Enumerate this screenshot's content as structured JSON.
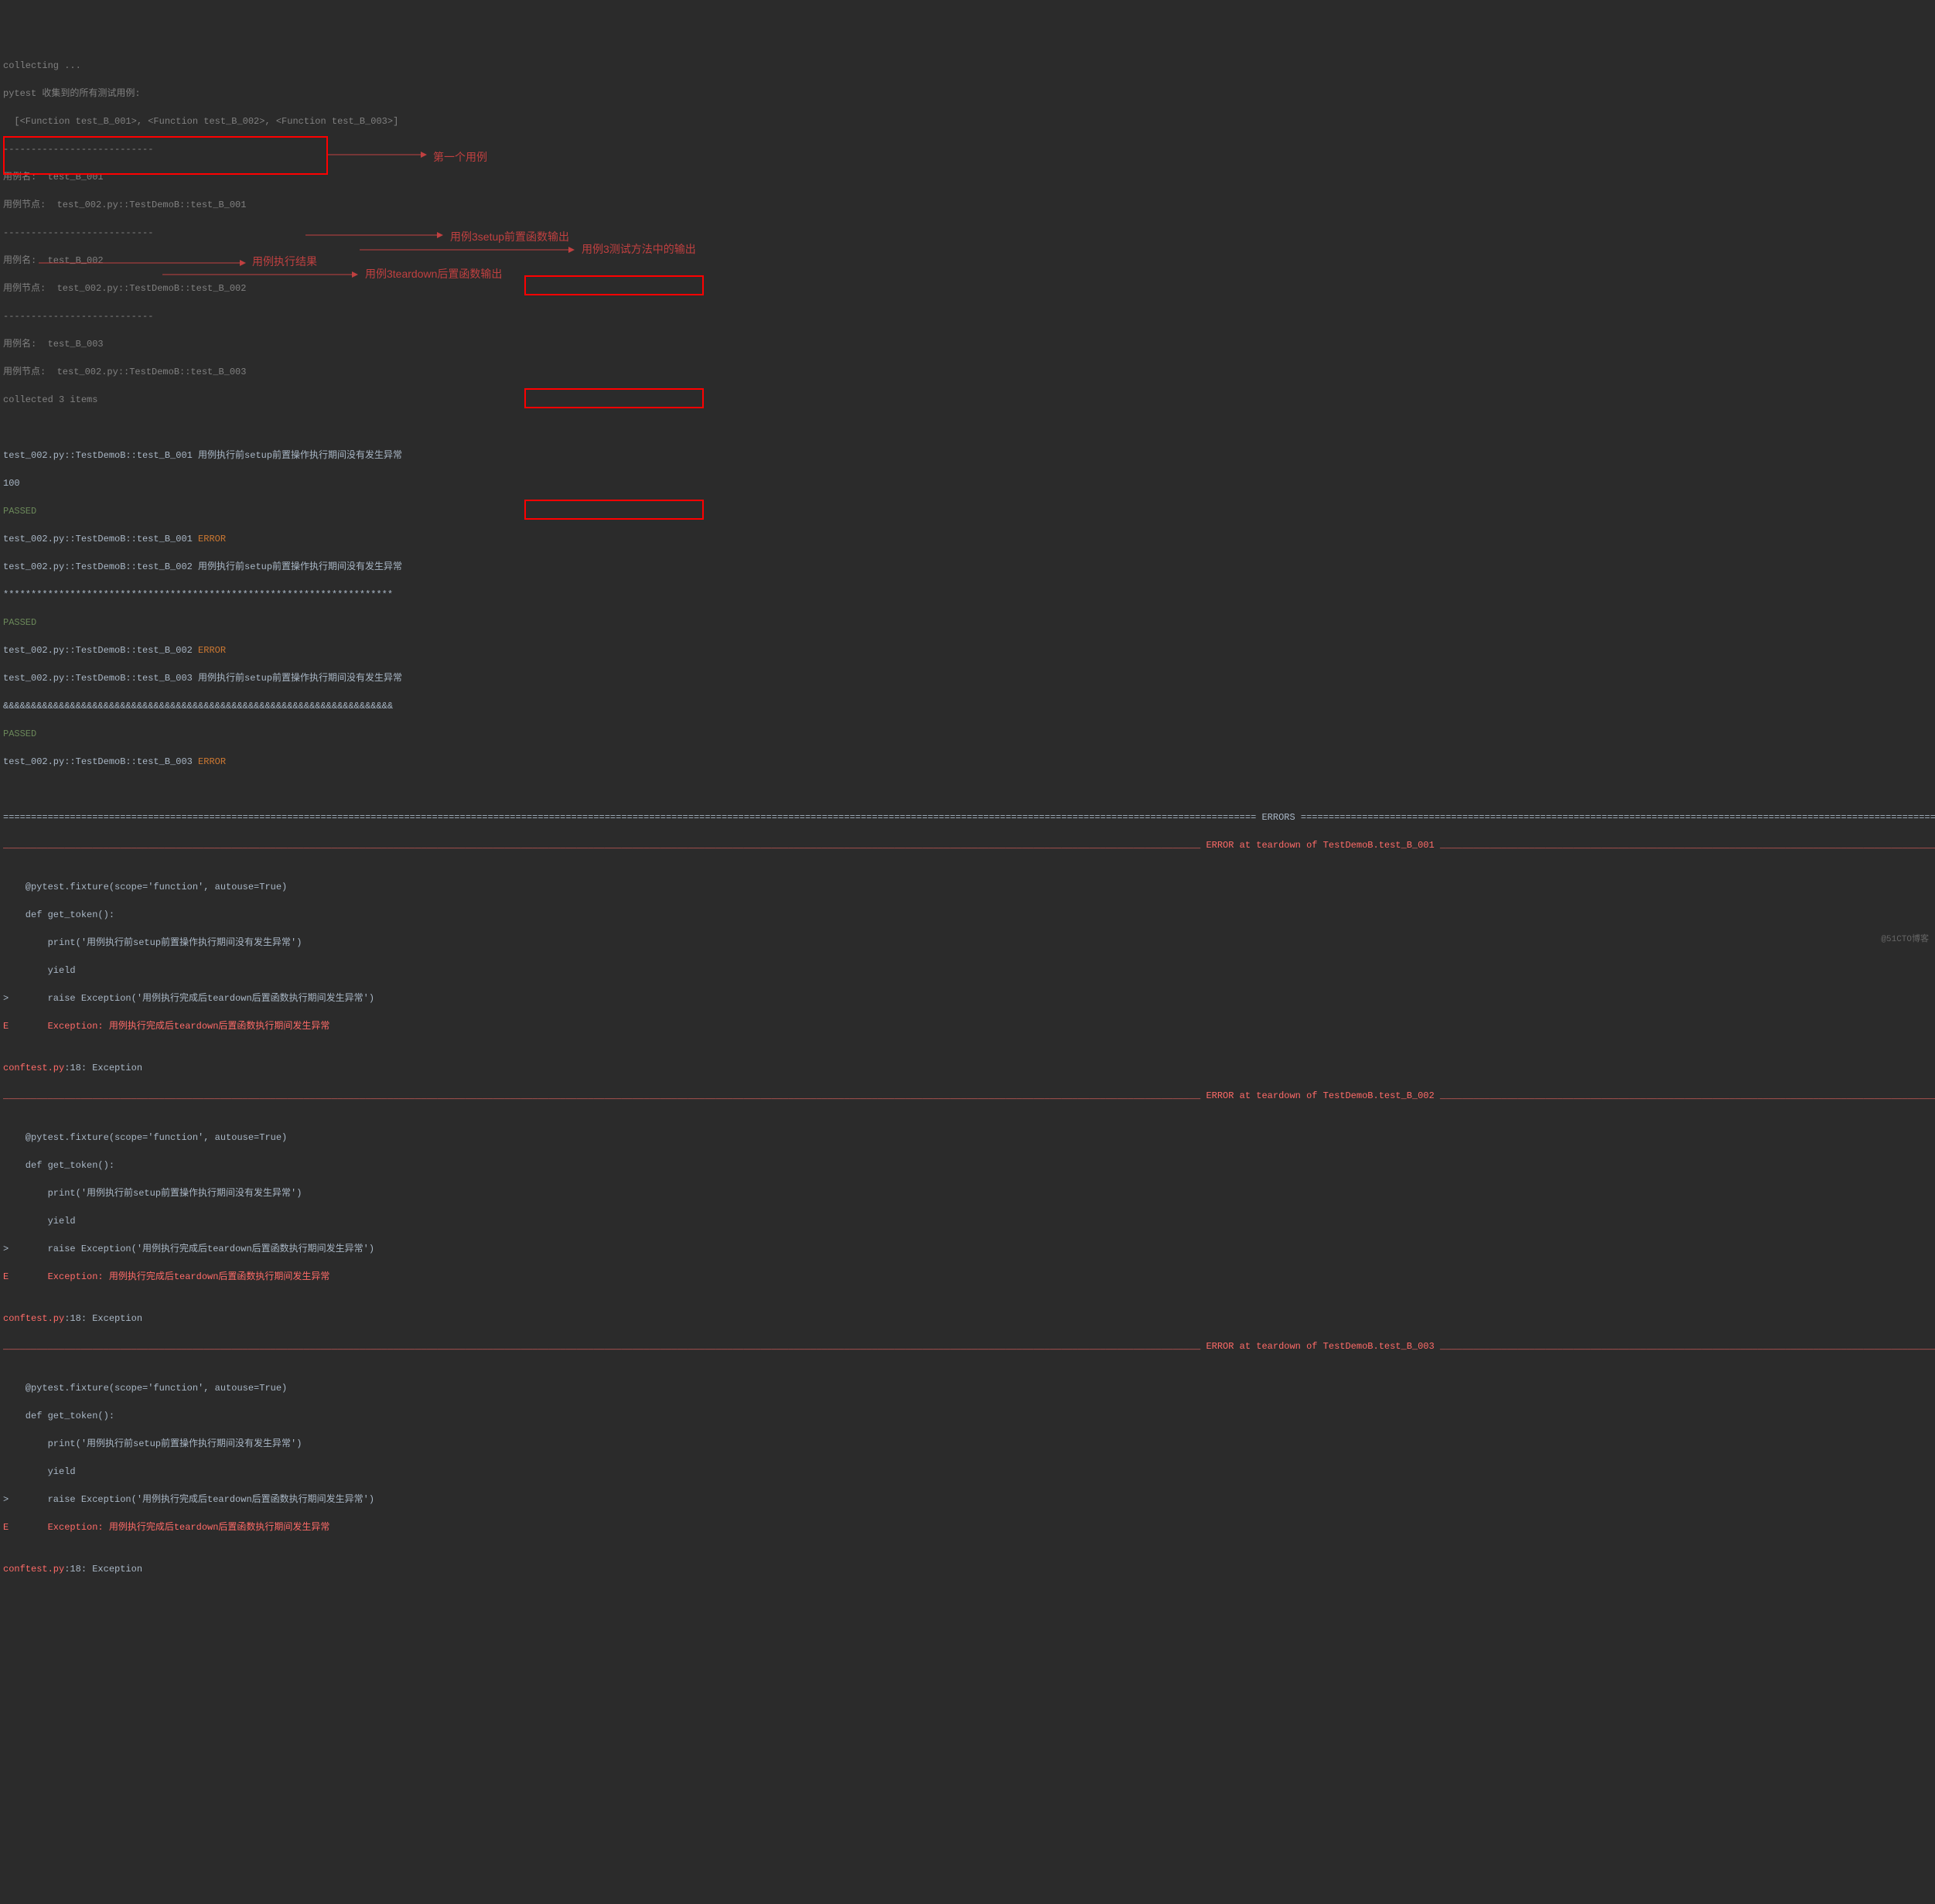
{
  "watermark": "@51CTO博客",
  "header": {
    "collecting": "collecting ...",
    "pytest_header": "pytest 收集到的所有测试用例:",
    "function_list": "  [<Function test_B_001>, <Function test_B_002>, <Function test_B_003>]",
    "sep": "---------------------------",
    "case1_name": "用例名:  test_B_001",
    "case1_node": "用例节点:  test_002.py::TestDemoB::test_B_001",
    "case2_name": "用例名:  test_B_002",
    "case2_node": "用例节点:  test_002.py::TestDemoB::test_B_002",
    "case3_name": "用例名:  test_B_003",
    "case3_node": "用例节点:  test_002.py::TestDemoB::test_B_003",
    "collected": "collected 3 items"
  },
  "run": {
    "t1_setup": "test_002.py::TestDemoB::test_B_001 用例执行前setup前置操作执行期间没有发生异常",
    "t1_out": "100",
    "passed": "PASSED",
    "t1_err": "test_002.py::TestDemoB::test_B_001 ",
    "error_word": "ERROR",
    "t2_setup": "test_002.py::TestDemoB::test_B_002 用例执行前setup前置操作执行期间没有发生异常",
    "t2_out": "**********************************************************************",
    "t2_err": "test_002.py::TestDemoB::test_B_002 ",
    "t3_setup": "test_002.py::TestDemoB::test_B_003 用例执行前setup前置操作执行期间没有发生异常",
    "t3_out": "&&&&&&&&&&&&&&&&&&&&&&&&&&&&&&&&&&&&&&&&&&&&&&&&&&&&&&&&&&&&&&&&&&&&&&",
    "t3_err": "test_002.py::TestDemoB::test_B_003 "
  },
  "errors_section": {
    "header_line": "================================================================================================================================================================================================================================= ERRORS ==================================================================================================================================================================================================================================",
    "teardown1": "_______________________________________________________________________________________________________________________________________________________________________________________________________________________ ERROR at teardown of TestDemoB.test_B_001 ________________________________________________________________________________________________________________________________________________________________________________________________________________________",
    "teardown2": "_______________________________________________________________________________________________________________________________________________________________________________________________________________________ ERROR at teardown of TestDemoB.test_B_002 ________________________________________________________________________________________________________________________________________________________________________________________________________________________",
    "teardown3": "_______________________________________________________________________________________________________________________________________________________________________________________________________________________ ERROR at teardown of TestDemoB.test_B_003 ________________________________________________________________________________________________________________________________________________________________________________________________________________________"
  },
  "traceback": {
    "blank": "",
    "fixture_line": "    @pytest.fixture(scope='function', autouse=True)",
    "def_line": "    def get_token():",
    "print_line": "        print('用例执行前setup前置操作执行期间没有发生异常')",
    "yield_line": "        yield",
    "raise_line": ">       raise Exception('用例执行完成后teardown后置函数执行期间发生异常')",
    "e_prefix": "E       ",
    "exception_line": "Exception: 用例执行完成后teardown后置函数执行期间发生异常",
    "location": "conftest.py",
    "location_suffix": ":18: Exception"
  },
  "annotations": {
    "first_case": "第一个用例",
    "setup_output": "用例3setup前置函数输出",
    "method_output": "用例3测试方法中的输出",
    "exec_result": "用例执行结果",
    "teardown_output": "用例3teardown后置函数输出"
  }
}
